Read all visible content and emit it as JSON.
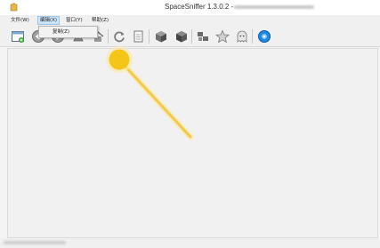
{
  "window": {
    "title": "SpaceSniffer 1.3.0.2 -"
  },
  "menubar": {
    "items": [
      {
        "label": "文件(W)"
      },
      {
        "label": "编辑(X)"
      },
      {
        "label": "窗口(Y)"
      },
      {
        "label": "帮助(Z)"
      }
    ]
  },
  "dropdown": {
    "items": [
      {
        "label": "复制(Z)"
      }
    ]
  },
  "toolbar": {
    "buttons": [
      {
        "icon": "new-scan-icon"
      },
      {
        "icon": "back-icon"
      },
      {
        "icon": "forward-icon"
      },
      {
        "icon": "up-icon"
      },
      {
        "icon": "home-icon"
      },
      {
        "icon": "refresh-icon"
      },
      {
        "icon": "copy-icon"
      },
      {
        "icon": "cube-icon"
      },
      {
        "icon": "cube-dark-icon"
      },
      {
        "icon": "tags-icon"
      },
      {
        "icon": "star-icon"
      },
      {
        "icon": "ghost-icon"
      },
      {
        "icon": "help-globe-icon"
      }
    ]
  },
  "colors": {
    "highlight_dot": "#f5c518",
    "menu_active_bg": "#cce4f7",
    "help_icon": "#1e88e5"
  }
}
